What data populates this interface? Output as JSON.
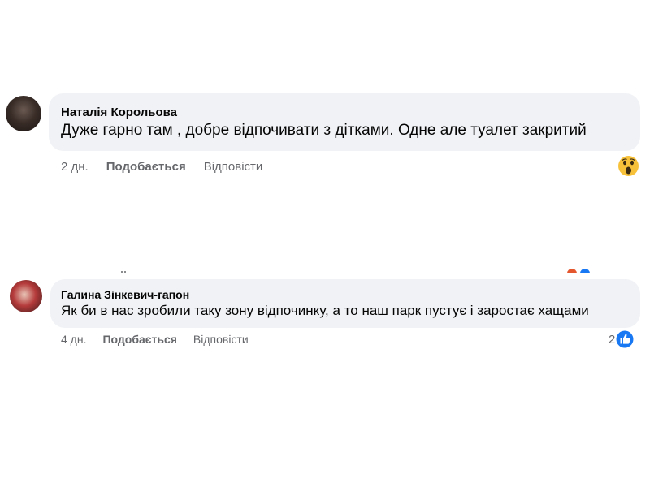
{
  "comments": [
    {
      "author": "Наталія Корольова",
      "text": "Дуже гарно там , добре відпочивати з дітками. Одне але туалет закритий",
      "time": "2 дн.",
      "like_label": "Подобається",
      "reply_label": "Відповісти",
      "reaction": "wow-icon",
      "reaction_count": ""
    },
    {
      "author": "Галина Зінкевич-гапон",
      "text": "Як би в нас зробили таку зону відпочинку, а то наш парк пустує і заростає хащами",
      "time": "4 дн.",
      "like_label": "Подобається",
      "reply_label": "Відповісти",
      "reaction": "like-icon",
      "reaction_count": "2"
    }
  ],
  "colors": {
    "bubble": "#f0f2f5",
    "meta_text": "#65676b",
    "like_blue": "#1877f2",
    "wow_yellow": "#f7c23a"
  }
}
